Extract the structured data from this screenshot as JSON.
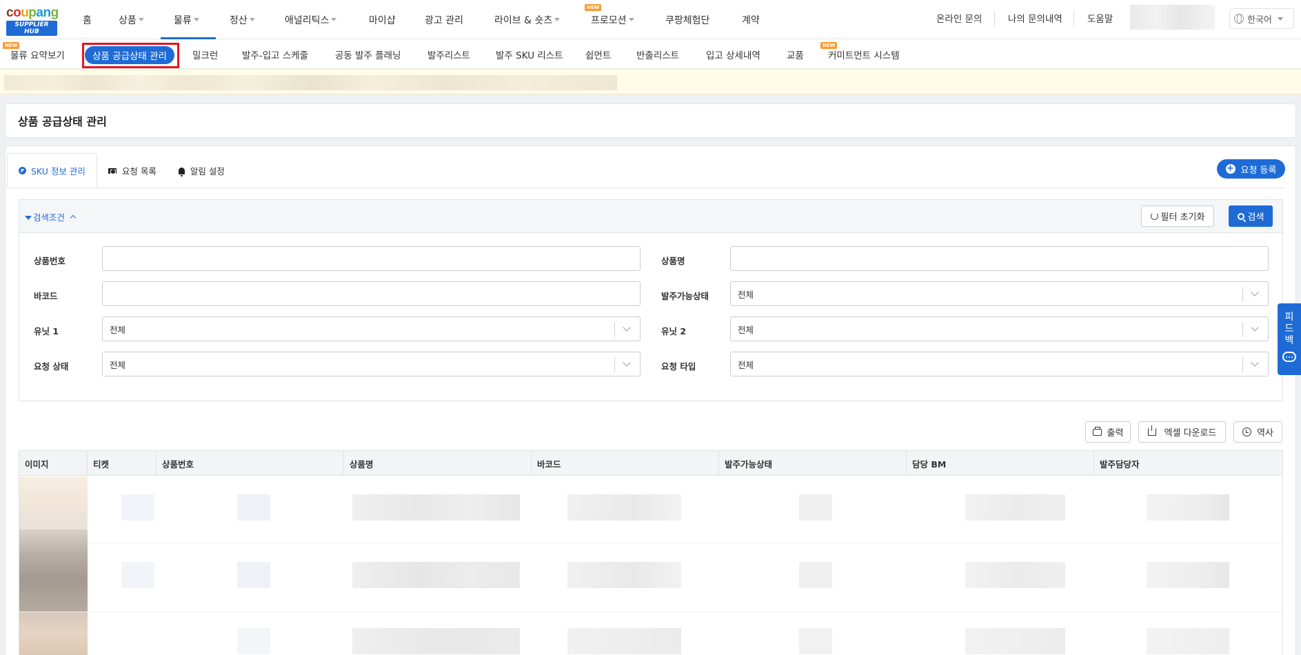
{
  "brand": {
    "wordmark": "coupang",
    "subtitle": "SUPPLIER HUB"
  },
  "top_menu": [
    {
      "label": "홈",
      "caret": false
    },
    {
      "label": "상품",
      "caret": true
    },
    {
      "label": "물류",
      "caret": true,
      "active": true
    },
    {
      "label": "정산",
      "caret": true
    },
    {
      "label": "애널리틱스",
      "caret": true
    },
    {
      "label": "마이샵",
      "caret": false
    },
    {
      "label": "광고 관리",
      "caret": false
    },
    {
      "label": "라이브 & 숏츠",
      "caret": true
    },
    {
      "label": "프로모션",
      "caret": true,
      "badge": "NEW"
    },
    {
      "label": "쿠팡체험단",
      "caret": false
    },
    {
      "label": "계약",
      "caret": false
    }
  ],
  "top_right": {
    "inquiry": "온라인 문의",
    "my_inquiries": "나의 문의내역",
    "help": "도움말",
    "language": "한국어"
  },
  "sub_menu": [
    {
      "label": "물류 요약보기",
      "badge": "NEW"
    },
    {
      "label": "상품 공급상태 관리",
      "active": true
    },
    {
      "label": "밀크런"
    },
    {
      "label": "발주-입고 스케줄"
    },
    {
      "label": "공동 발주 플래닝"
    },
    {
      "label": "발주리스트"
    },
    {
      "label": "발주 SKU 리스트"
    },
    {
      "label": "쉽먼트"
    },
    {
      "label": "반출리스트"
    },
    {
      "label": "입고 상세내역"
    },
    {
      "label": "교품"
    },
    {
      "label": "커미트먼트 시스템",
      "badge": "NEW"
    }
  ],
  "page": {
    "title": "상품 공급상태 관리"
  },
  "tabs": [
    {
      "label": "SKU 정보 관리",
      "icon": "sku-icon",
      "active": true
    },
    {
      "label": "요청 목록",
      "icon": "ticket-icon"
    },
    {
      "label": "알림 설정",
      "icon": "bell-icon"
    }
  ],
  "request_button": "요청 등록",
  "search": {
    "header_label": "검색조건",
    "reset_label": "필터 초기화",
    "search_label": "검색",
    "fields": {
      "product_no": {
        "label": "상품번호",
        "value": ""
      },
      "product_name": {
        "label": "상품명",
        "value": ""
      },
      "barcode": {
        "label": "바코드",
        "value": ""
      },
      "order_status": {
        "label": "발주가능상태",
        "value": "전체"
      },
      "unit1": {
        "label": "유닛 1",
        "value": "전체"
      },
      "unit2": {
        "label": "유닛 2",
        "value": "전체"
      },
      "request_status": {
        "label": "요청 상태",
        "value": "전체"
      },
      "request_type": {
        "label": "요청 타입",
        "value": "전체"
      }
    }
  },
  "actions": {
    "print": "출력",
    "excel": "엑셀 다운로드",
    "history": "역사"
  },
  "table": {
    "columns": [
      "이미지",
      "티켓",
      "상품번호",
      "상품명",
      "바코드",
      "발주가능상태",
      "담당 BM",
      "발주담당자"
    ]
  },
  "feedback": {
    "label_chars": [
      "피",
      "드",
      "백"
    ]
  },
  "colors": {
    "accent": "#1e6bd6",
    "highlight_border": "#e8141b",
    "new_badge": "#f59b36",
    "notice_bg": "#fefbe6"
  }
}
